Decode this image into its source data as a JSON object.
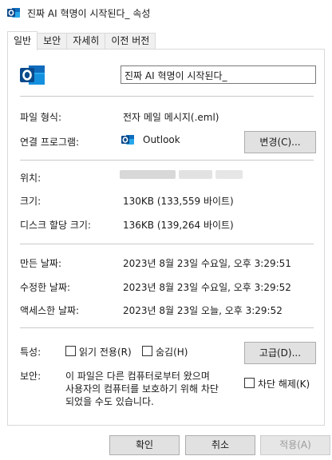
{
  "window": {
    "title": "진짜 AI 혁명이 시작된다_ 속성"
  },
  "tabs": [
    {
      "label": "일반"
    },
    {
      "label": "보안"
    },
    {
      "label": "자세히"
    },
    {
      "label": "이전 버전"
    }
  ],
  "general": {
    "file_name": "진짜 AI 혁명이 시작된다_",
    "file_type_label": "파일 형식:",
    "file_type_value": "전자 메일 메시지(.eml)",
    "opens_with_label": "연결 프로그램:",
    "opens_with_value": "Outlook",
    "change_button": "변경(C)...",
    "location_label": "위치:",
    "size_label": "크기:",
    "size_value": "130KB (133,559 바이트)",
    "disk_size_label": "디스크 할당 크기:",
    "disk_size_value": "136KB (139,264 바이트)",
    "created_label": "만든 날짜:",
    "created_value": "2023년 8월 23일 수요일, 오후 3:29:51",
    "modified_label": "수정한 날짜:",
    "modified_value": "2023년 8월 23일 수요일, 오후 3:29:52",
    "accessed_label": "액세스한 날짜:",
    "accessed_value": "2023년 8월 23일 오늘, 오후 3:29:52",
    "attributes_label": "특성:",
    "readonly_label": "읽기 전용(R)",
    "hidden_label": "숨김(H)",
    "advanced_button": "고급(D)...",
    "security_label": "보안:",
    "security_line1": "이 파일은 다른 컴퓨터로부터 왔으며",
    "security_line2": "사용자의 컴퓨터를 보호하기 위해 차단",
    "security_line3": "되었을 수도 있습니다.",
    "unblock_label": "차단 해제(K)"
  },
  "footer": {
    "ok": "확인",
    "cancel": "취소",
    "apply": "적용(A)"
  },
  "colors": {
    "outlook_blue": "#0f6cbd",
    "outlook_dark": "#0a4a8c"
  },
  "icons": [
    "outlook-icon"
  ]
}
